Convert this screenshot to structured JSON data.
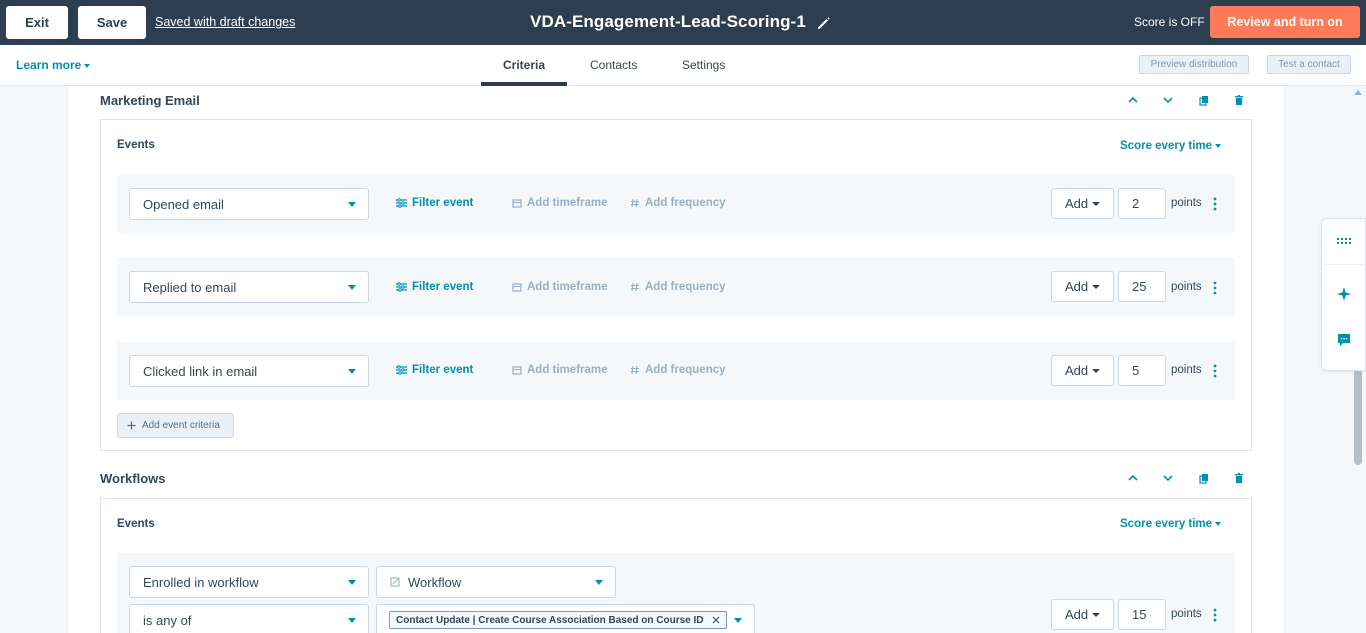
{
  "topbar": {
    "exit_label": "Exit",
    "save_label": "Save",
    "draft_status": "Saved with draft changes",
    "title": "VDA-Engagement-Lead-Scoring-1",
    "score_status": "Score is OFF",
    "review_label": "Review and turn on"
  },
  "subbar": {
    "learn_more": "Learn more",
    "tabs": [
      {
        "label": "Criteria",
        "active": true
      },
      {
        "label": "Contacts",
        "active": false
      },
      {
        "label": "Settings",
        "active": false
      }
    ],
    "preview_label": "Preview distribution",
    "test_label": "Test a contact"
  },
  "sections": [
    {
      "title": "Marketing Email",
      "events_label": "Events",
      "score_every": "Score every time",
      "rows": [
        {
          "event": "Opened email",
          "filter": "Filter event",
          "timeframe": "Add timeframe",
          "frequency": "Add frequency",
          "operation": "Add",
          "points_value": "2",
          "points_label": "points"
        },
        {
          "event": "Replied to email",
          "filter": "Filter event",
          "timeframe": "Add timeframe",
          "frequency": "Add frequency",
          "operation": "Add",
          "points_value": "25",
          "points_label": "points"
        },
        {
          "event": "Clicked link in email",
          "filter": "Filter event",
          "timeframe": "Add timeframe",
          "frequency": "Add frequency",
          "operation": "Add",
          "points_value": "5",
          "points_label": "points"
        }
      ],
      "add_criteria": "Add event criteria"
    },
    {
      "title": "Workflows",
      "events_label": "Events",
      "score_every": "Score every time",
      "row": {
        "event": "Enrolled in workflow",
        "object": "Workflow",
        "operator": "is any of",
        "tag": "Contact Update | Create Course Association Based on Course ID",
        "operation": "Add",
        "points_value": "15",
        "points_label": "points"
      }
    }
  ],
  "colors": {
    "topbar_bg": "#2d3e50",
    "accent": "#0091ae",
    "cta": "#ff7a59"
  },
  "icons": [
    "pencil-icon",
    "chevron-up-icon",
    "chevron-down-icon",
    "copy-icon",
    "trash-icon",
    "filter-icon",
    "calendar-icon",
    "hash-icon",
    "kebab-icon",
    "grid-icon",
    "sparkle-icon",
    "chat-icon",
    "plus-icon",
    "workflow-icon",
    "close-icon"
  ]
}
